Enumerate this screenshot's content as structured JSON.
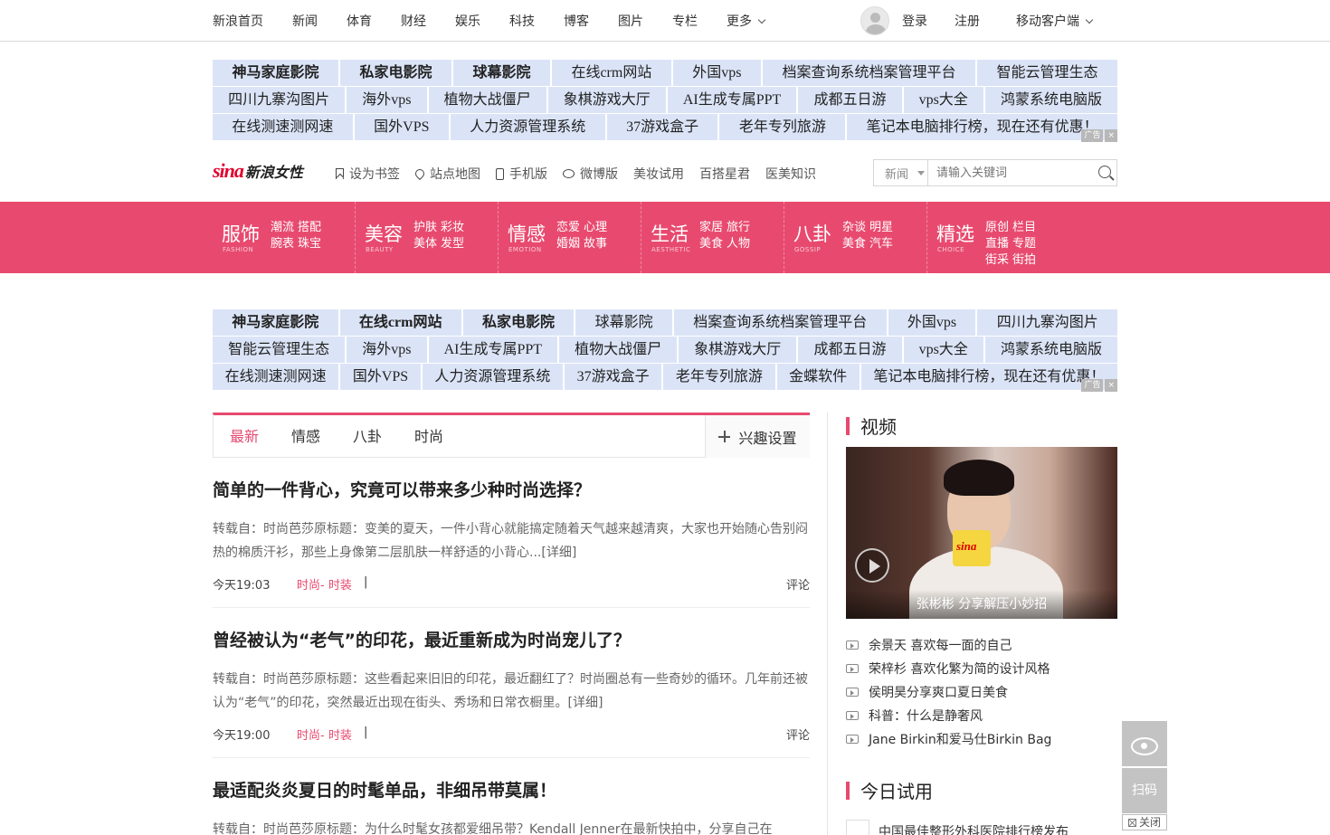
{
  "topnav": {
    "items": [
      "新浪首页",
      "新闻",
      "体育",
      "财经",
      "娱乐",
      "科技",
      "博客",
      "图片",
      "专栏"
    ],
    "more": "更多",
    "login": "登录",
    "register": "注册",
    "mobile": "移动客户端"
  },
  "ad_block_1": {
    "rows": [
      [
        {
          "t": "神马家庭影院",
          "b": true
        },
        {
          "t": "私家电影院",
          "b": true
        },
        {
          "t": "球幕影院",
          "b": true
        },
        {
          "t": "在线crm网站",
          "b": false
        },
        {
          "t": "外国vps",
          "b": false
        },
        {
          "t": "档案查询系统档案管理平台",
          "b": false
        },
        {
          "t": "智能云管理生态",
          "b": false
        }
      ],
      [
        {
          "t": "四川九寨沟图片",
          "b": false
        },
        {
          "t": "海外vps",
          "b": false
        },
        {
          "t": "植物大战僵尸",
          "b": false
        },
        {
          "t": "象棋游戏大厅",
          "b": false
        },
        {
          "t": "AI生成专属PPT",
          "b": false
        },
        {
          "t": "成都五日游",
          "b": false
        },
        {
          "t": "vps大全",
          "b": false
        },
        {
          "t": "鸿蒙系统电脑版",
          "b": false
        }
      ],
      [
        {
          "t": "在线测速测网速",
          "b": false
        },
        {
          "t": "国外VPS",
          "b": false
        },
        {
          "t": "人力资源管理系统",
          "b": false
        },
        {
          "t": "37游戏盒子",
          "b": false
        },
        {
          "t": "老年专列旅游",
          "b": false
        },
        {
          "t": "笔记本电脑排行榜，现在还有优惠！",
          "b": false
        }
      ]
    ],
    "tag": [
      "广告",
      "×"
    ]
  },
  "ad_block_2": {
    "rows": [
      [
        {
          "t": "神马家庭影院",
          "b": true
        },
        {
          "t": "在线crm网站",
          "b": true
        },
        {
          "t": "私家电影院",
          "b": true
        },
        {
          "t": "球幕影院",
          "b": false
        },
        {
          "t": "档案查询系统档案管理平台",
          "b": false
        },
        {
          "t": "外国vps",
          "b": false
        },
        {
          "t": "四川九寨沟图片",
          "b": false
        }
      ],
      [
        {
          "t": "智能云管理生态",
          "b": false
        },
        {
          "t": "海外vps",
          "b": false
        },
        {
          "t": "AI生成专属PPT",
          "b": false
        },
        {
          "t": "植物大战僵尸",
          "b": false
        },
        {
          "t": "象棋游戏大厅",
          "b": false
        },
        {
          "t": "成都五日游",
          "b": false
        },
        {
          "t": "vps大全",
          "b": false
        },
        {
          "t": "鸿蒙系统电脑版",
          "b": false
        }
      ],
      [
        {
          "t": "在线测速测网速",
          "b": false
        },
        {
          "t": "国外VPS",
          "b": false
        },
        {
          "t": "人力资源管理系统",
          "b": false
        },
        {
          "t": "37游戏盒子",
          "b": false
        },
        {
          "t": "老年专列旅游",
          "b": false
        },
        {
          "t": "金蝶软件",
          "b": false
        },
        {
          "t": "笔记本电脑排行榜，现在还有优惠！",
          "b": false
        }
      ]
    ],
    "tag": [
      "广告",
      "×"
    ]
  },
  "logobar": {
    "logo_sina": "sina",
    "logo_text": "新浪女性",
    "links": [
      {
        "label": "设为书签",
        "icon": "bookmark-icon"
      },
      {
        "label": "站点地图",
        "icon": "map-pin-icon"
      },
      {
        "label": "手机版",
        "icon": "phone-icon"
      },
      {
        "label": "微博版",
        "icon": "weibo-icon"
      },
      {
        "label": "美妆试用",
        "icon": ""
      },
      {
        "label": "百搭星君",
        "icon": ""
      },
      {
        "label": "医美知识",
        "icon": ""
      }
    ],
    "search_select": "新闻",
    "search_placeholder": "请输入关键词"
  },
  "channels": [
    {
      "title": "服饰",
      "en": "FASHION",
      "subs": [
        "潮流",
        "搭配",
        "腕表",
        "珠宝"
      ]
    },
    {
      "title": "美容",
      "en": "BEAUTY",
      "subs": [
        "护肤",
        "彩妆",
        "美体",
        "发型"
      ]
    },
    {
      "title": "情感",
      "en": "EMOTION",
      "subs": [
        "恋爱",
        "心理",
        "婚姻",
        "故事"
      ]
    },
    {
      "title": "生活",
      "en": "AESTHETIC",
      "subs": [
        "家居",
        "旅行",
        "美食",
        "人物"
      ]
    },
    {
      "title": "八卦",
      "en": "GOSSIP",
      "subs": [
        "杂谈",
        "明星",
        "美食",
        "汽车"
      ]
    },
    {
      "title": "精选",
      "en": "CHOICE",
      "subs": [
        "原创",
        "栏目",
        "直播",
        "专题",
        "街采",
        "街拍"
      ]
    }
  ],
  "feed": {
    "tabs": [
      "最新",
      "情感",
      "八卦",
      "时尚"
    ],
    "active_tab": 0,
    "settings_label": "兴趣设置",
    "articles": [
      {
        "title": "简单的一件背心，究竟可以带来多少种时尚选择？",
        "summary": "转载自：时尚芭莎原标题：变美的夏天，一件小背心就能搞定随着天气越来越清爽，大家也开始随心告别闷热的棉质汗衫，那些上身像第二层肌肤一样舒适的小背心...",
        "more": "[详细]",
        "time": "今天19:03",
        "category": "时尚- 时装",
        "sep": "|",
        "comment": "评论"
      },
      {
        "title": "曾经被认为“老气”的印花，最近重新成为时尚宠儿了？",
        "summary": "转载自：时尚芭莎原标题：这些看起来旧旧的印花，最近翻红了？时尚圈总有一些奇妙的循环。几年前还被认为“老气”的印花，突然最近出现在街头、秀场和日常衣橱里。",
        "more": "[详细]",
        "time": "今天19:00",
        "category": "时尚- 时装",
        "sep": "|",
        "comment": "评论"
      },
      {
        "title": "最适配炎炎夏日的时髦单品，非细吊带莫属！",
        "summary": "转载自：时尚芭莎原标题：为什么时髦女孩都爱细吊带？Kendall Jenner在最新快拍中，分享自己在",
        "more": "",
        "time": "",
        "category": "",
        "sep": "",
        "comment": ""
      }
    ]
  },
  "sidebar": {
    "video_title": "视频",
    "video_caption": "张彬彬 分享解压小妙招",
    "video_mic_logo": "sina",
    "video_list": [
      "余景天 喜欢每一面的自己",
      "荣梓杉 喜欢化繁为简的设计风格",
      "侯明昊分享爽口夏日美食",
      "科普：什么是静奢风",
      "Jane Birkin和爱马仕Birkin Bag"
    ],
    "trial_title": "今日试用",
    "trial_first": "中国最佳整形外科医院排行榜发布"
  },
  "float_tools": {
    "scan": "扫码",
    "close": "关闭"
  },
  "colors": {
    "brand_pink": "#e84a6f",
    "ad_bg": "#dbe4f7",
    "logo_red": "#e1002d"
  }
}
